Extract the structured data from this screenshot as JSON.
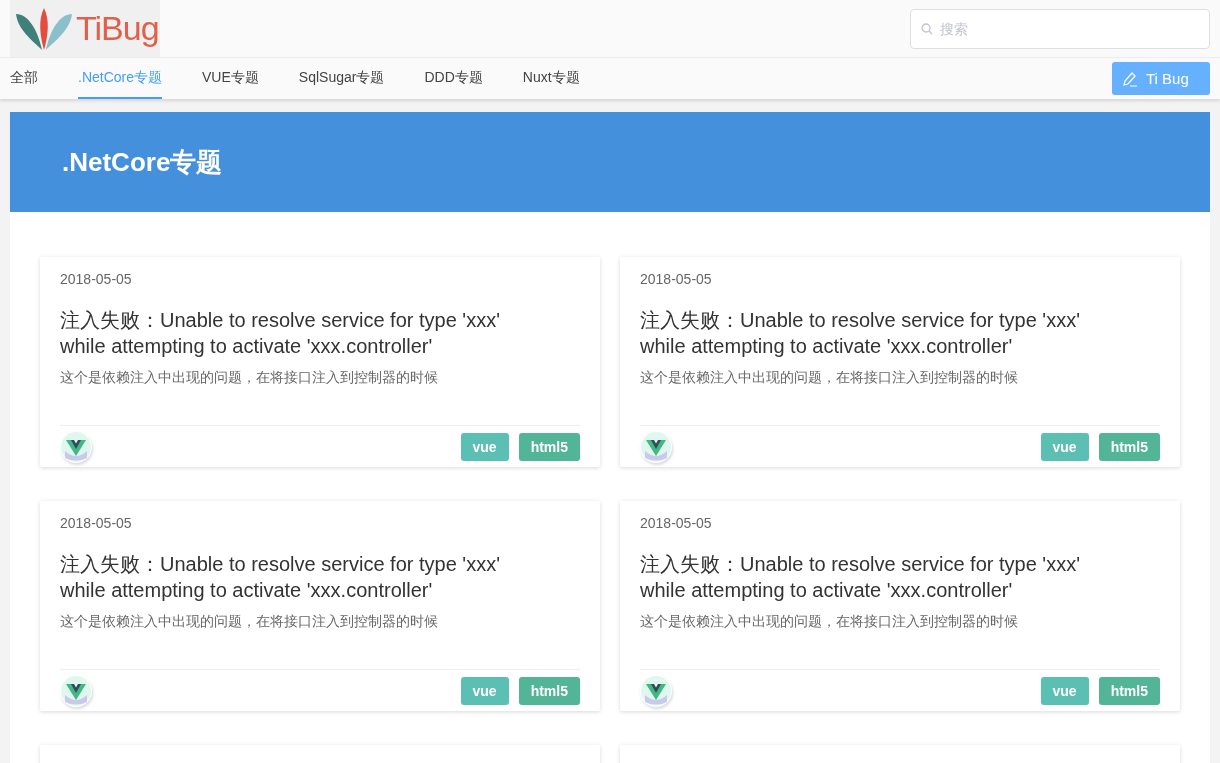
{
  "header": {
    "logo_text": "TiBug",
    "search": {
      "placeholder": "搜索"
    }
  },
  "nav": {
    "tabs": [
      {
        "label": "全部",
        "selected": false
      },
      {
        "label": ".NetCore专题",
        "selected": true
      },
      {
        "label": "VUE专题",
        "selected": false
      },
      {
        "label": "SqlSugar专题",
        "selected": false
      },
      {
        "label": "DDD专题",
        "selected": false
      },
      {
        "label": "Nuxt专题",
        "selected": false
      }
    ],
    "action_button": "Ti Bug"
  },
  "banner": {
    "title": ".NetCore专题"
  },
  "cards": [
    {
      "kind": "full",
      "date": "2018-05-05",
      "title": "注入失败：Unable to resolve service for type 'xxx' while attempting to activate 'xxx.controller'",
      "summary": "这个是依赖注入中出现的问题，在将接口注入到控制器的时候",
      "tags": [
        {
          "label": "vue",
          "color": "#5bbfb3"
        },
        {
          "label": "html5",
          "color": "#52b595"
        }
      ]
    },
    {
      "kind": "full",
      "date": "2018-05-05",
      "title": "注入失败：Unable to resolve service for type 'xxx' while attempting to activate 'xxx.controller'",
      "summary": "这个是依赖注入中出现的问题，在将接口注入到控制器的时候",
      "tags": [
        {
          "label": "vue",
          "color": "#5bbfb3"
        },
        {
          "label": "html5",
          "color": "#52b595"
        }
      ]
    },
    {
      "kind": "full",
      "date": "2018-05-05",
      "title": "注入失败：Unable to resolve service for type 'xxx' while attempting to activate 'xxx.controller'",
      "summary": "这个是依赖注入中出现的问题，在将接口注入到控制器的时候",
      "tags": [
        {
          "label": "vue",
          "color": "#5bbfb3"
        },
        {
          "label": "html5",
          "color": "#52b595"
        }
      ]
    },
    {
      "kind": "full",
      "date": "2018-05-05",
      "title": "注入失败：Unable to resolve service for type 'xxx' while attempting to activate 'xxx.controller'",
      "summary": "这个是依赖注入中出现的问题，在将接口注入到控制器的时候",
      "tags": [
        {
          "label": "vue",
          "color": "#5bbfb3"
        },
        {
          "label": "html5",
          "color": "#52b595"
        }
      ]
    },
    {
      "kind": "stub"
    },
    {
      "kind": "stub"
    }
  ]
}
